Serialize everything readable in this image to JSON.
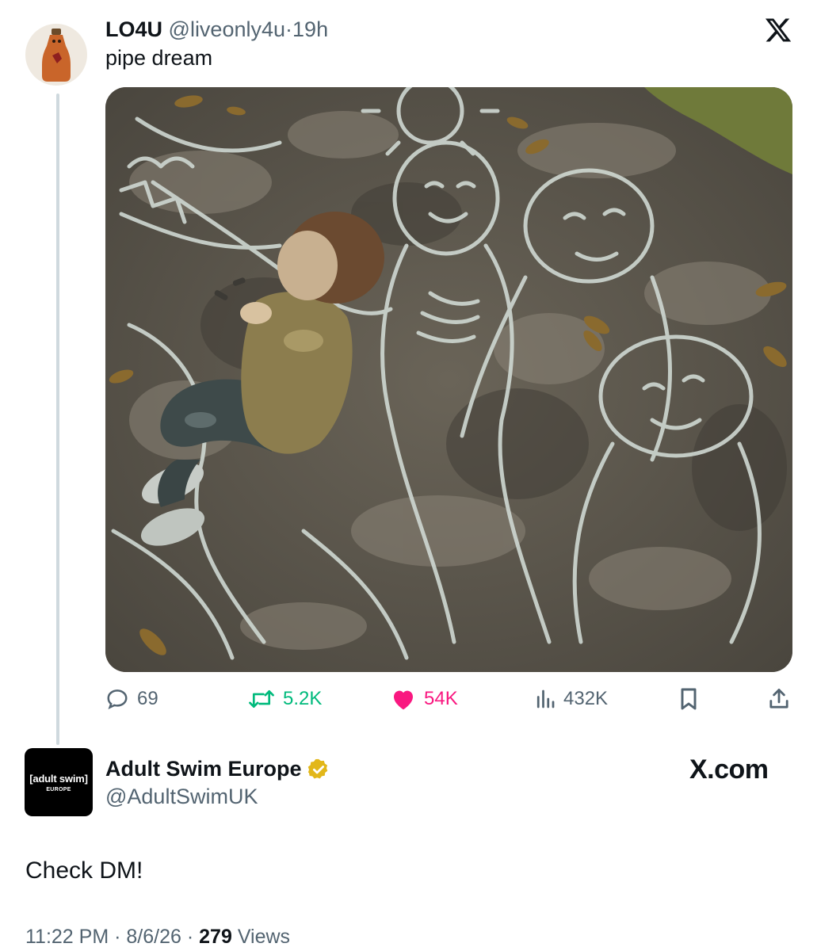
{
  "tweet": {
    "display_name": "LO4U",
    "handle": "@liveonly4u",
    "separator": "·",
    "age": "19h",
    "text": "pipe dream",
    "stats": {
      "replies": "69",
      "reposts": "5.2K",
      "likes": "54K",
      "views": "432K"
    }
  },
  "reply": {
    "avatar_brand": "[adult swim]",
    "avatar_sub": "EUROPE",
    "display_name": "Adult Swim Europe",
    "handle": "@AdultSwimUK",
    "text": "Check DM!",
    "time": "11:22 PM",
    "date": "8/6/26",
    "views_count": "279",
    "views_label": "Views",
    "separator": "·"
  },
  "watermark": "X.com",
  "colors": {
    "text": "#0f1419",
    "muted": "#536471",
    "repost": "#00ba7c",
    "like": "#f91880",
    "verified": "#e2b719"
  }
}
